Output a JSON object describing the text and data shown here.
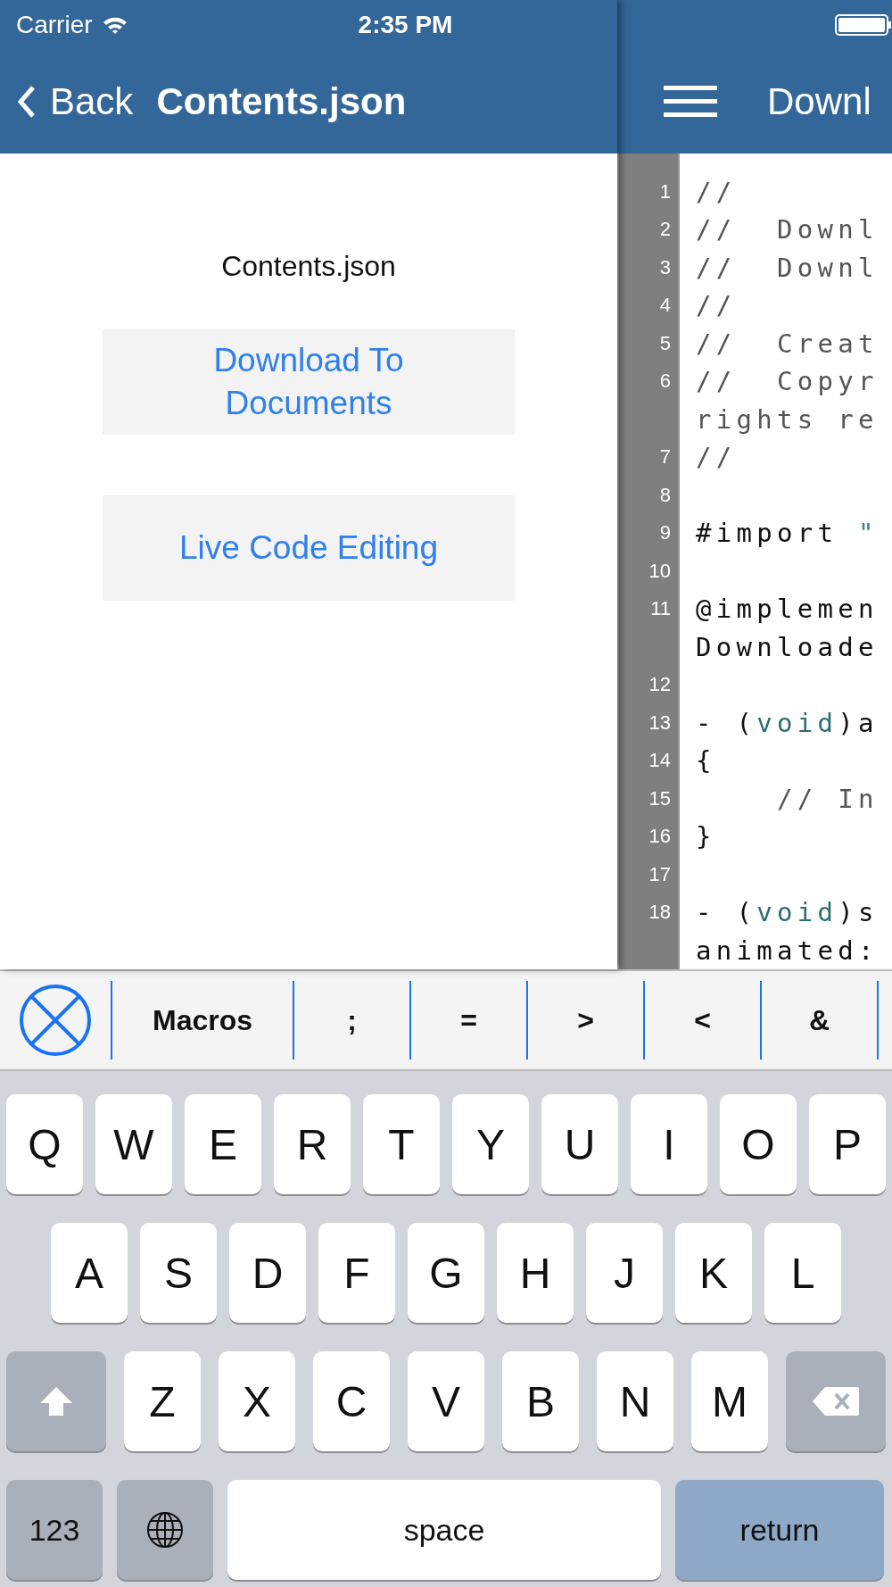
{
  "status_bar": {
    "carrier": "Carrier",
    "time": "2:35 PM"
  },
  "file_pane": {
    "back": "Back",
    "title": "Contents.json",
    "file_name": "Contents.json",
    "buttons": [
      "Download To Documents",
      "Live Code Editing"
    ]
  },
  "editor_pane": {
    "title": "Downl",
    "lines": [
      {
        "number": "1",
        "parts": [
          {
            "text": "//",
            "kind": "comment"
          }
        ]
      },
      {
        "number": "2",
        "parts": [
          {
            "text": "//  Downl",
            "kind": "comment"
          }
        ]
      },
      {
        "number": "3",
        "parts": [
          {
            "text": "//  Downl",
            "kind": "comment"
          }
        ]
      },
      {
        "number": "4",
        "parts": [
          {
            "text": "//",
            "kind": "comment"
          }
        ]
      },
      {
        "number": "5",
        "parts": [
          {
            "text": "//  Creat",
            "kind": "comment"
          }
        ]
      },
      {
        "number": "6",
        "parts": [
          {
            "text": "//  Copyr",
            "kind": "comment"
          }
        ],
        "wrap": [
          {
            "text": "rights re",
            "kind": "comment"
          }
        ]
      },
      {
        "number": "7",
        "parts": [
          {
            "text": "//",
            "kind": "comment"
          }
        ]
      },
      {
        "number": "8"
      },
      {
        "number": "9",
        "parts": [
          {
            "text": "#import ",
            "kind": "plain"
          },
          {
            "text": "\"",
            "kind": "string"
          }
        ]
      },
      {
        "number": "10"
      },
      {
        "number": "11",
        "parts": [
          {
            "text": "@implemen",
            "kind": "plain"
          }
        ],
        "wrap": [
          {
            "text": "Downloade",
            "kind": "plain"
          }
        ]
      },
      {
        "number": "12"
      },
      {
        "number": "13",
        "parts": [
          {
            "text": "- (",
            "kind": "plain"
          },
          {
            "text": "void",
            "kind": "keyword"
          },
          {
            "text": ")a",
            "kind": "plain"
          }
        ]
      },
      {
        "number": "14",
        "parts": [
          {
            "text": "{",
            "kind": "plain"
          }
        ]
      },
      {
        "number": "15",
        "parts": [
          {
            "text": "    // In",
            "kind": "comment"
          }
        ]
      },
      {
        "number": "16",
        "parts": [
          {
            "text": "}",
            "kind": "plain"
          }
        ]
      },
      {
        "number": "17"
      },
      {
        "number": "18",
        "parts": [
          {
            "text": "- (",
            "kind": "plain"
          },
          {
            "text": "void",
            "kind": "keyword"
          },
          {
            "text": ")s",
            "kind": "plain"
          }
        ],
        "wrap": [
          {
            "text": "animated:",
            "kind": "plain"
          }
        ]
      }
    ]
  },
  "accessory_bar": [
    "Macros",
    ";",
    "=",
    ">",
    "<",
    "&"
  ],
  "keyboard": [
    [
      {
        "kind": "letter",
        "label": "Q"
      },
      {
        "kind": "letter",
        "label": "W"
      },
      {
        "kind": "letter",
        "label": "E"
      },
      {
        "kind": "letter",
        "label": "R"
      },
      {
        "kind": "letter",
        "label": "T"
      },
      {
        "kind": "letter",
        "label": "Y"
      },
      {
        "kind": "letter",
        "label": "U"
      },
      {
        "kind": "letter",
        "label": "I"
      },
      {
        "kind": "letter",
        "label": "O"
      },
      {
        "kind": "letter",
        "label": "P"
      }
    ],
    [
      {
        "kind": "letter",
        "label": "A"
      },
      {
        "kind": "letter",
        "label": "S"
      },
      {
        "kind": "letter",
        "label": "D"
      },
      {
        "kind": "letter",
        "label": "F"
      },
      {
        "kind": "letter",
        "label": "G"
      },
      {
        "kind": "letter",
        "label": "H"
      },
      {
        "kind": "letter",
        "label": "J"
      },
      {
        "kind": "letter",
        "label": "K"
      },
      {
        "kind": "letter",
        "label": "L"
      }
    ],
    [
      {
        "kind": "shift"
      },
      {
        "kind": "letter",
        "label": "Z"
      },
      {
        "kind": "letter",
        "label": "X"
      },
      {
        "kind": "letter",
        "label": "C"
      },
      {
        "kind": "letter",
        "label": "V"
      },
      {
        "kind": "letter",
        "label": "B"
      },
      {
        "kind": "letter",
        "label": "N"
      },
      {
        "kind": "letter",
        "label": "M"
      },
      {
        "kind": "delete"
      }
    ],
    [
      {
        "kind": "numbers",
        "label": "123"
      },
      {
        "kind": "globe"
      },
      {
        "kind": "space",
        "label": "space"
      },
      {
        "kind": "return",
        "label": "return"
      }
    ]
  ]
}
